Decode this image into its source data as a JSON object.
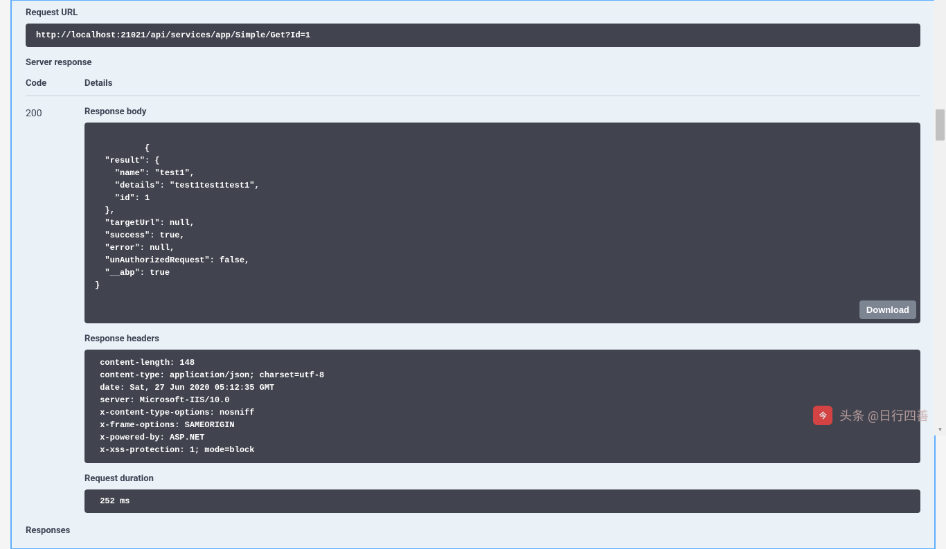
{
  "labels": {
    "request_url": "Request URL",
    "server_response": "Server response",
    "code_header": "Code",
    "details_header": "Details",
    "response_body": "Response body",
    "response_headers": "Response headers",
    "request_duration": "Request duration",
    "responses": "Responses",
    "download": "Download"
  },
  "request": {
    "url": "http://localhost:21021/api/services/app/Simple/Get?Id=1"
  },
  "response": {
    "code": "200",
    "body": "{\n  \"result\": {\n    \"name\": \"test1\",\n    \"details\": \"test1test1test1\",\n    \"id\": 1\n  },\n  \"targetUrl\": null,\n  \"success\": true,\n  \"error\": null,\n  \"unAuthorizedRequest\": false,\n  \"__abp\": true\n}",
    "headers": " content-length: 148 \n content-type: application/json; charset=utf-8 \n date: Sat, 27 Jun 2020 05:12:35 GMT \n server: Microsoft-IIS/10.0 \n x-content-type-options: nosniff \n x-frame-options: SAMEORIGIN \n x-powered-by: ASP.NET \n x-xss-protection: 1; mode=block ",
    "duration": " 252 ms"
  },
  "watermark": {
    "text": "头条 @日行四善",
    "logo": "今"
  }
}
